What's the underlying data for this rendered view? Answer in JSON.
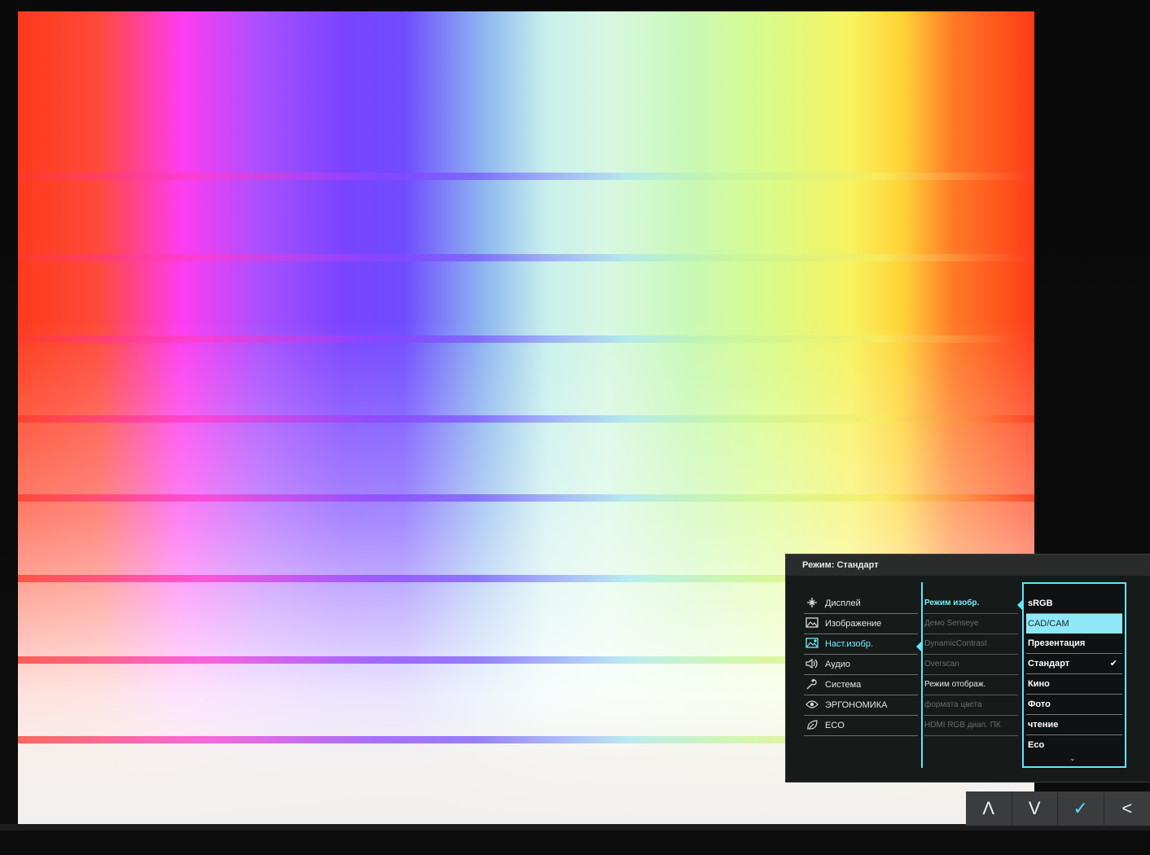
{
  "osd": {
    "title": "Режим: Стандарт",
    "menu": [
      {
        "label": "Дисплей",
        "icon": "display-icon"
      },
      {
        "label": "Изображение",
        "icon": "picture-icon"
      },
      {
        "label": "Наст.изобр.",
        "icon": "picture-advanced-icon",
        "active": true
      },
      {
        "label": "Аудио",
        "icon": "audio-icon"
      },
      {
        "label": "Система",
        "icon": "system-icon"
      },
      {
        "label": "ЭРГОНОМИКА",
        "icon": "eye-icon"
      },
      {
        "label": "ECO",
        "icon": "eco-leaf-icon"
      }
    ],
    "submenu": [
      {
        "label": "Режим изобр.",
        "state": "active"
      },
      {
        "label": "Демо Senseye",
        "state": "disabled"
      },
      {
        "label": "DynamicContrast",
        "state": "disabled"
      },
      {
        "label": "Overscan",
        "state": "disabled"
      },
      {
        "label": "Режим отображ.",
        "state": "enabled"
      },
      {
        "label": "формата цвета",
        "state": "disabled"
      },
      {
        "label": "HDMI RGB диап. ПК",
        "state": "disabled"
      }
    ],
    "options": [
      {
        "label": "sRGB"
      },
      {
        "label": "CAD/CAM",
        "highlight": true
      },
      {
        "label": "Презентация"
      },
      {
        "label": "Стандарт",
        "selected": true
      },
      {
        "label": "Кино"
      },
      {
        "label": "Фото"
      },
      {
        "label": "чтение"
      },
      {
        "label": "Eco"
      }
    ],
    "check_mark": "✔",
    "more_indicator": "⌄"
  },
  "buttons": [
    {
      "name": "up-button",
      "label": "Λ"
    },
    {
      "name": "down-button",
      "label": "V"
    },
    {
      "name": "confirm-button",
      "label": "✓"
    },
    {
      "name": "back-button",
      "label": "<"
    }
  ],
  "colors": {
    "accent": "#5fe7ff",
    "highlight": "#8fe8f8",
    "osd_bg": "#161a19"
  }
}
